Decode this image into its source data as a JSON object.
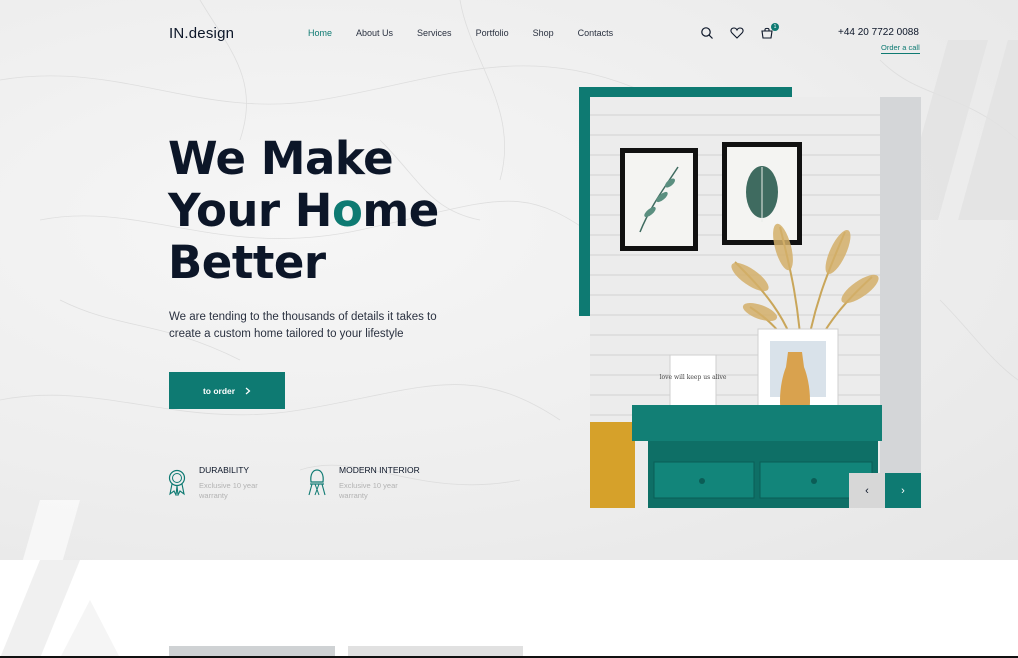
{
  "header": {
    "logo": "IN.design",
    "nav": [
      "Home",
      "About Us",
      "Services",
      "Portfolio",
      "Shop",
      "Contacts"
    ],
    "active_nav": "Home",
    "icons": [
      "search-icon",
      "heart-icon",
      "cart-icon"
    ],
    "cart_count": "1",
    "phone": "+44 20 7722 0088",
    "order_call": "Order a call"
  },
  "hero": {
    "headline_line1": "We Make",
    "headline_line2_a": "Your H",
    "headline_line2_o": "o",
    "headline_line2_b": "me",
    "headline_line3": "Better",
    "subtext": "We are tending to the thousands of details it takes to create a custom home tailored to your lifestyle",
    "cta_label": "to order",
    "features": [
      {
        "title": "DURABILITY",
        "desc": "Exclusive 10 year warranty",
        "icon": "award-badge-icon"
      },
      {
        "title": "MODERN INTERIOR",
        "desc": "Exclusive 10 year warranty",
        "icon": "chair-icon"
      }
    ]
  },
  "slider": {
    "prev": "‹",
    "next": "›"
  },
  "photo": {
    "card_text": "love will keep us alive"
  },
  "colors": {
    "accent": "#0e7a72",
    "dark": "#0c1628",
    "muted": "#b3b3b3"
  }
}
